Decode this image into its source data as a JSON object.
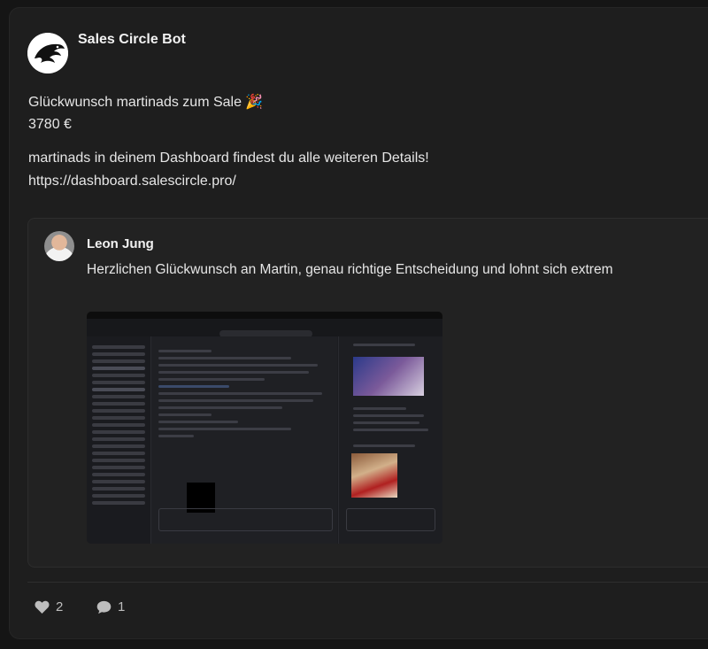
{
  "post": {
    "author": "Sales Circle Bot",
    "line1": "Glückwunsch martinads zum Sale 🎉",
    "line2": "3780 €",
    "line3": "martinads in deinem Dashboard findest du alle weiteren Details!",
    "line4": "https://dashboard.salescircle.pro/"
  },
  "quote": {
    "author": "Leon Jung",
    "text": "Herzlichen Glückwunsch an Martin, genau richtige Entscheidung und lohnt sich extrem"
  },
  "reactions": {
    "likes": "2",
    "comments": "1"
  },
  "icons": {
    "bot_avatar": "eagle-logo-icon",
    "like": "heart-icon",
    "comment": "speech-bubble-icon"
  }
}
